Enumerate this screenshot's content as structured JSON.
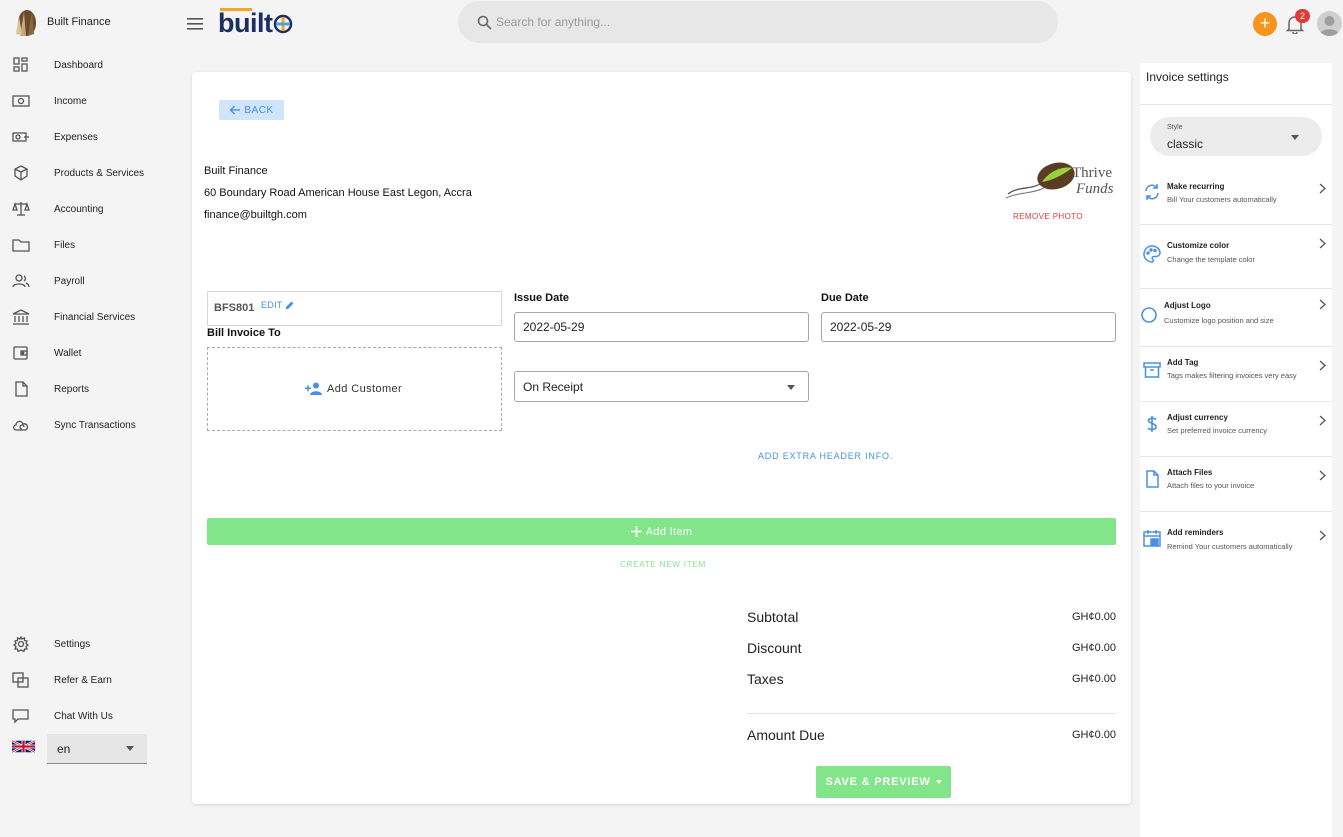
{
  "brand": {
    "name": "Built Finance"
  },
  "sidebar": {
    "items": [
      {
        "label": "Dashboard",
        "icon": "dashboard-icon"
      },
      {
        "label": "Income",
        "icon": "income-icon"
      },
      {
        "label": "Expenses",
        "icon": "expenses-icon"
      },
      {
        "label": "Products & Services",
        "icon": "box-icon"
      },
      {
        "label": "Accounting",
        "icon": "scale-icon"
      },
      {
        "label": "Files",
        "icon": "folder-icon"
      },
      {
        "label": "Payroll",
        "icon": "people-icon"
      },
      {
        "label": "Financial Services",
        "icon": "bank-icon"
      },
      {
        "label": "Wallet",
        "icon": "wallet-icon"
      },
      {
        "label": "Reports",
        "icon": "document-icon"
      },
      {
        "label": "Sync Transactions",
        "icon": "cloud-sync-icon"
      }
    ],
    "bottom_items": [
      {
        "label": "Settings",
        "icon": "gear-icon"
      },
      {
        "label": "Refer & Earn",
        "icon": "refer-icon"
      },
      {
        "label": "Chat With Us",
        "icon": "chat-icon"
      }
    ],
    "language": {
      "value": "en",
      "flag": "uk-flag-icon"
    }
  },
  "topbar": {
    "logo_text": "built",
    "search_placeholder": "Search for anything...",
    "notification_count": "2",
    "accent_color": "#f7941d"
  },
  "invoice": {
    "back_label": "BACK",
    "company": {
      "name": "Built Finance",
      "address": "60 Boundary Road American House East Legon, Accra",
      "email": "finance@builtgh.com"
    },
    "logo": {
      "line1": "Thrive",
      "line2": "Funds"
    },
    "remove_photo_label": "REMOVE PHOTO",
    "number": "BFS801",
    "edit_label": "EDIT",
    "bill_to_label": "Bill Invoice To",
    "add_customer_label": "Add Customer",
    "issue_date_label": "Issue Date",
    "issue_date": "2022-05-29",
    "due_date_label": "Due Date",
    "due_date": "2022-05-29",
    "terms": "On Receipt",
    "extra_header_label": "ADD EXTRA HEADER INFO.",
    "add_item_label": "Add Item",
    "create_item_label": "CREATE NEW ITEM",
    "totals": {
      "subtotal_label": "Subtotal",
      "subtotal": "GH¢0.00",
      "discount_label": "Discount",
      "discount": "GH¢0.00",
      "taxes_label": "Taxes",
      "taxes": "GH¢0.00",
      "amount_due_label": "Amount Due",
      "amount_due": "GH¢0.00"
    },
    "save_label": "SAVE & PREVIEW",
    "green_color": "#82e58a"
  },
  "settings": {
    "title": "Invoice settings",
    "style_label": "Style",
    "style_value": "classic",
    "options": [
      {
        "title": "Make recurring",
        "subtitle": "Bill Your customers automatically",
        "icon": "recurring-icon"
      },
      {
        "title": "Customize color",
        "subtitle": "Change the template color",
        "icon": "palette-icon"
      },
      {
        "title": "Adjust Logo",
        "subtitle": "Customize logo position and size",
        "icon": "circle-icon"
      },
      {
        "title": "Add Tag",
        "subtitle": "Tags makes filtering invoices very easy",
        "icon": "tag-box-icon"
      },
      {
        "title": "Adjust currency",
        "subtitle": "Set preferred invoice currency",
        "icon": "dollar-icon"
      },
      {
        "title": "Attach Files",
        "subtitle": "Attach files to your invoice",
        "icon": "file-icon"
      },
      {
        "title": "Add reminders",
        "subtitle": "Remind Your customers automatically",
        "icon": "reminder-icon"
      }
    ]
  }
}
